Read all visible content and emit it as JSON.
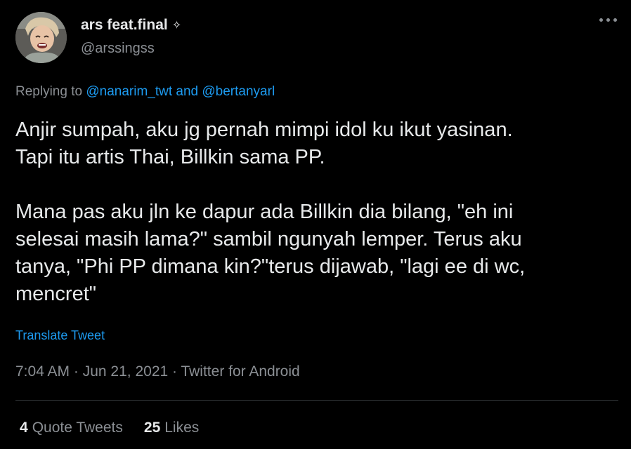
{
  "author": {
    "name": "ars feat.final",
    "badge_icon": "sparkle-icon",
    "handle": "@arssingss"
  },
  "reply": {
    "prefix": "Replying to ",
    "user1": "@nanarim_twt",
    "conjunction": " and ",
    "user2": "@bertanyarl"
  },
  "tweet": {
    "paragraphs": [
      "Anjir sumpah, aku jg pernah mimpi idol ku ikut yasinan.\nTapi itu artis Thai, Billkin sama PP.",
      "Mana pas aku jln ke dapur ada Billkin dia bilang, \"eh ini\nselesai masih lama?\" sambil ngunyah lemper. Terus aku\ntanya, \"Phi PP dimana kin?\"terus dijawab, \"lagi ee di wc,\nmencret\""
    ],
    "translate_label": "Translate Tweet"
  },
  "meta": {
    "time": "7:04 AM",
    "separator": " · ",
    "date": "Jun 21, 2021",
    "source": "Twitter for Android"
  },
  "stats": {
    "quote_count": "4",
    "quote_label": "Quote Tweets",
    "like_count": "25",
    "like_label": "Likes"
  },
  "colors": {
    "background": "#000000",
    "text": "#e7e9ea",
    "secondary": "#8b8f94",
    "link": "#1d9bf0",
    "divider": "#2f3336"
  }
}
